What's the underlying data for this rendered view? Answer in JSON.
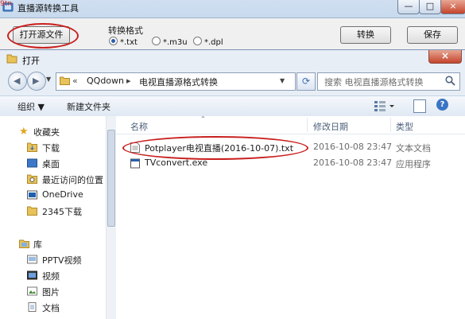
{
  "tool_window": {
    "title": "直播源转换工具",
    "watermark": "9tn",
    "open_button": "打开源文件",
    "format_label": "转换格式",
    "formats": [
      {
        "label": "*.txt",
        "selected": true
      },
      {
        "label": "*.m3u",
        "selected": false
      },
      {
        "label": "*.dpl",
        "selected": false
      }
    ],
    "convert_button": "转换",
    "save_button": "保存",
    "minimize_glyph": "—",
    "maximize_glyph": "□"
  },
  "dialog": {
    "title": "打开",
    "close_glyph": "×",
    "address": {
      "crumbs": [
        "QQdown",
        "电视直播源格式转换"
      ],
      "separator": "«",
      "separator2": "▸"
    },
    "search_placeholder": "搜索 电视直播源格式转换",
    "toolbar": {
      "organize": "组织 ▼",
      "new_folder": "新建文件夹",
      "help": "?"
    },
    "nav": {
      "favorites_label": "收藏夹",
      "favorites": [
        "下载",
        "桌面",
        "最近访问的位置"
      ],
      "onedrive": "OneDrive",
      "custom": "2345下载",
      "libraries_label": "库",
      "libraries": [
        "PPTV视频",
        "视频",
        "图片",
        "文档"
      ]
    },
    "columns": {
      "name": "名称",
      "modified": "修改日期",
      "type": "类型"
    },
    "files": [
      {
        "name": "Potplayer电视直播(2016-10-07).txt",
        "modified": "2016-10-08 23:47",
        "type": "文本文档",
        "icon": "text-file-icon"
      },
      {
        "name": "TVconvert.exe",
        "modified": "2016-10-08 23:47",
        "type": "应用程序",
        "icon": "exe-file-icon"
      }
    ]
  },
  "colors": {
    "highlight": "#c8201e",
    "folder": "#e8c25a"
  }
}
